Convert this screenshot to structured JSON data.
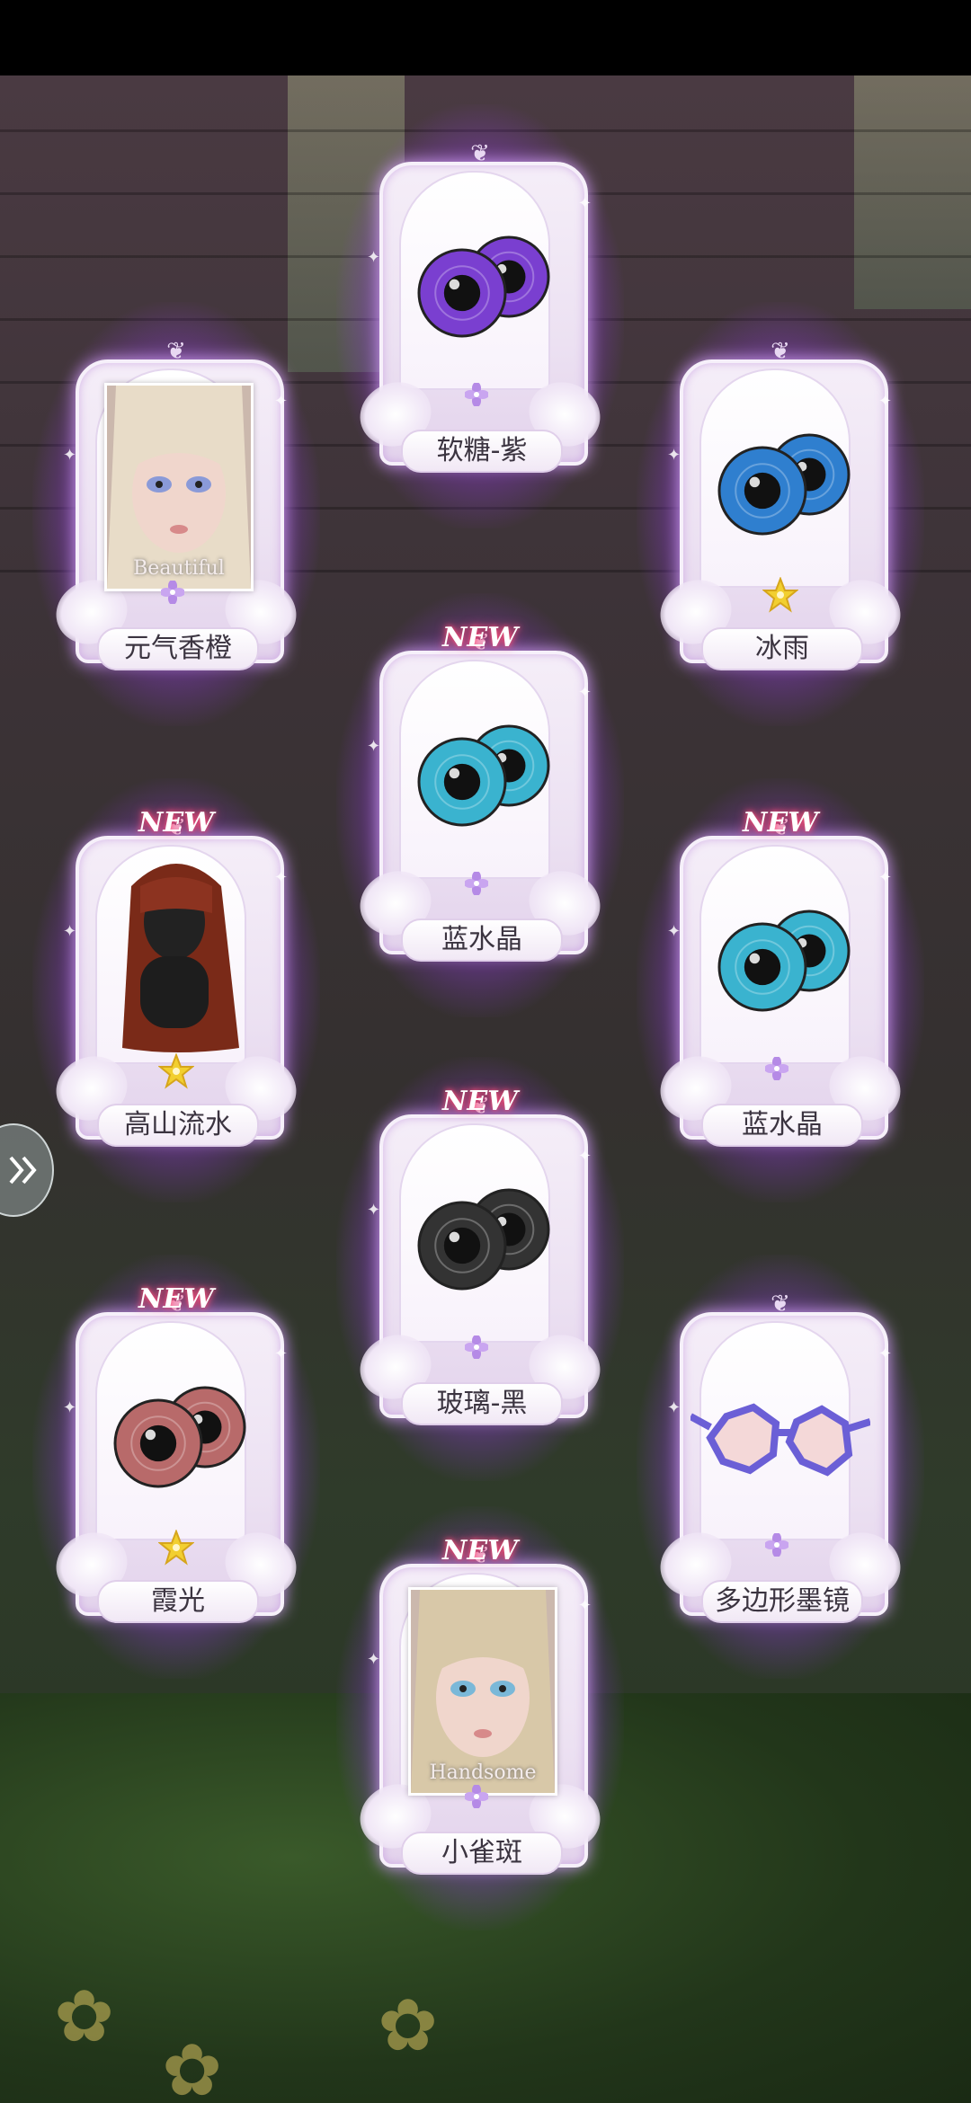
{
  "cards": [
    {
      "id": "c1",
      "name": "元气香橙",
      "new": false,
      "badge": "flower",
      "image": "portrait",
      "portrait_caption": "Beautiful"
    },
    {
      "id": "c2",
      "name": "软糖-紫",
      "new": false,
      "badge": "flower",
      "image": "eyes",
      "eye_color": "#7a3fd0"
    },
    {
      "id": "c3",
      "name": "冰雨",
      "new": false,
      "badge": "star",
      "image": "eyes",
      "eye_color": "#2f7fcf"
    },
    {
      "id": "c4",
      "name": "蓝水晶",
      "new": true,
      "badge": "flower",
      "image": "eyes",
      "eye_color": "#3ab3cf"
    },
    {
      "id": "c5",
      "name": "高山流水",
      "new": true,
      "badge": "star",
      "image": "hair"
    },
    {
      "id": "c6",
      "name": "蓝水晶",
      "new": true,
      "badge": "flower",
      "image": "eyes",
      "eye_color": "#3ab3cf"
    },
    {
      "id": "c7",
      "name": "玻璃-黑",
      "new": true,
      "badge": "flower",
      "image": "eyes",
      "eye_color": "#333333"
    },
    {
      "id": "c8",
      "name": "霞光",
      "new": true,
      "badge": "star",
      "image": "eyes",
      "eye_color": "#b86a6a"
    },
    {
      "id": "c9",
      "name": "多边形墨镜",
      "new": false,
      "badge": "flower",
      "image": "glasses"
    },
    {
      "id": "c10",
      "name": "小雀斑",
      "new": true,
      "badge": "flower",
      "image": "portrait",
      "portrait_caption": "Handsome"
    }
  ],
  "new_label": "NEW",
  "colors": {
    "glow": "#b050ff",
    "frame": "#f5eef8",
    "new_tag": "#f04f7e",
    "star": "#f2cf2f",
    "flower": "#b58ae6"
  }
}
